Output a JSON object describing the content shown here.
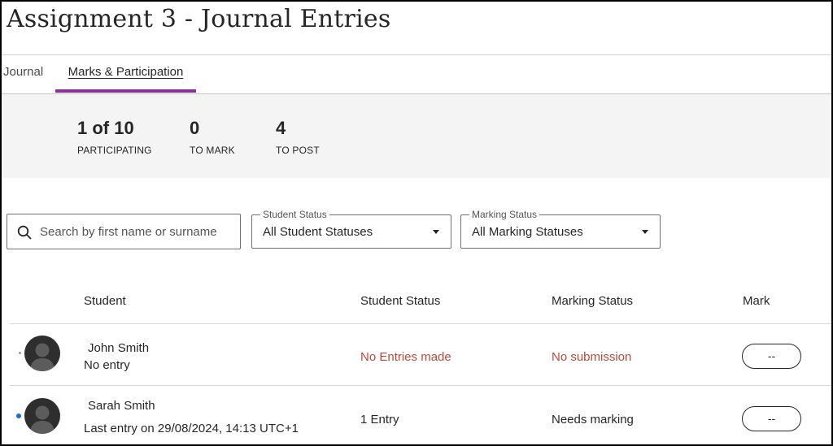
{
  "page": {
    "title": "Assignment 3 - Journal Entries"
  },
  "tabs": [
    {
      "label": "Journal",
      "active": false
    },
    {
      "label": "Marks & Participation",
      "active": true
    }
  ],
  "stats": {
    "participating": {
      "value": "1 of 10",
      "label": "PARTICIPATING"
    },
    "to_mark": {
      "value": "0",
      "label": "TO MARK"
    },
    "to_post": {
      "value": "4",
      "label": "TO POST"
    }
  },
  "filters": {
    "search": {
      "placeholder": "Search by first name or surname",
      "value": ""
    },
    "student_status": {
      "label": "Student Status",
      "selected": "All Student Statuses"
    },
    "marking_status": {
      "label": "Marking Status",
      "selected": "All Marking Statuses"
    }
  },
  "table": {
    "columns": [
      "Student",
      "Student Status",
      "Marking Status",
      "Mark"
    ],
    "rows": [
      {
        "name": "John Smith",
        "subtitle": "No entry",
        "student_status": "No Entries made",
        "marking_status": "No submission",
        "mark": "--"
      },
      {
        "name": "Sarah Smith",
        "subtitle": "Last entry on 29/08/2024, 14:13 UTC+1",
        "student_status": "1 Entry",
        "marking_status": "Needs marking",
        "mark": "--"
      }
    ]
  },
  "colors": {
    "accent": "#8c2f9c",
    "alert_text": "#b64b3d",
    "unread_dot": "#2168d9",
    "stats_background": "#f4f4f4"
  },
  "icons": {
    "search": "search-icon",
    "avatar": "user-silhouette-icon",
    "dropdown": "caret-down-icon"
  }
}
